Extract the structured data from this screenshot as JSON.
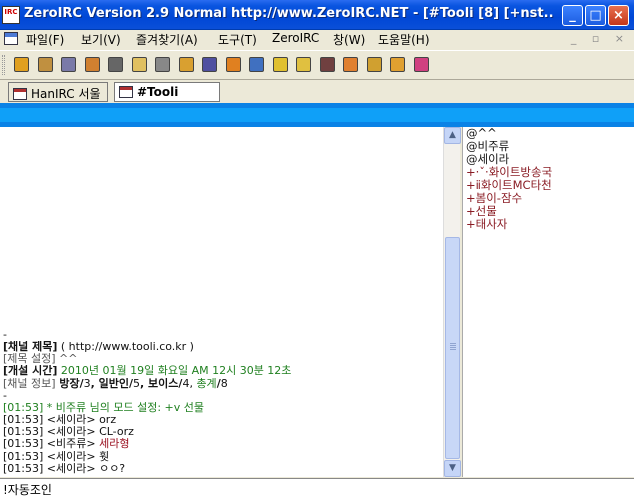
{
  "window": {
    "title": "ZeroIRC Version 2.9 Normal http://www.ZeroIRC.NET - [#Tooli [8] [+nst...",
    "app_icon_text": "IRC",
    "minimize": "_",
    "maximize": "□",
    "close": "×"
  },
  "menu": {
    "items": [
      "파일(F)",
      "보기(V)",
      "즐겨찾기(A)",
      "도구(T)",
      "ZeroIRC",
      "창(W)",
      "도움말(H)"
    ],
    "mdi_controls": "_ ▫ ×"
  },
  "toolbar": {
    "icons": [
      "connect-icon",
      "channel-icon",
      "server-icon",
      "user-icon",
      "edit-icon",
      "erase-icon",
      "timer-icon",
      "copy-icon",
      "paste-icon",
      "folder-icon",
      "options-icon",
      "refresh-icon",
      "open-icon",
      "palette-icon",
      "pie-icon",
      "layout-vertical-icon",
      "layout-cascade-icon",
      "about-icon"
    ]
  },
  "tabs": [
    {
      "label": "HanIRC 서울",
      "active": false
    },
    {
      "label": "#Tooli",
      "active": true
    }
  ],
  "chat": {
    "lines": [
      {
        "text": "-",
        "style": "black"
      },
      {
        "text": "[채널 제목] ( http://www.tooli.co.kr )",
        "parts": [
          [
            "[채널 제목]",
            "dark"
          ],
          [
            " ( http://www.tooli.co.kr )",
            "black"
          ]
        ]
      },
      {
        "parts": [
          [
            "[제목 설정]",
            "grey"
          ],
          [
            " ^^",
            "grey"
          ]
        ]
      },
      {
        "parts": [
          [
            "[개설 시간]",
            "dark"
          ],
          [
            " 2010년 01월 19일 화요일 AM 12시 30분 12초",
            "green"
          ]
        ]
      },
      {
        "parts": [
          [
            "[채널 정보]",
            "grey"
          ],
          [
            " 방장/",
            "dark"
          ],
          [
            "3",
            "black"
          ],
          [
            ", 일반인/",
            "dark"
          ],
          [
            "5",
            "black"
          ],
          [
            ", 보이스/",
            "dark"
          ],
          [
            "4",
            "black"
          ],
          [
            ", ",
            "black"
          ],
          [
            "총계",
            "green"
          ],
          [
            "/",
            "dark"
          ],
          [
            "8",
            "black"
          ]
        ]
      },
      {
        "parts": [
          [
            "-",
            "black"
          ]
        ]
      },
      {
        "parts": [
          [
            "[01:53] * 비주류 님의 모드 설정: +v 선물",
            "green"
          ]
        ]
      },
      {
        "parts": [
          [
            "[01:53] <세이라> orz",
            "black"
          ]
        ]
      },
      {
        "parts": [
          [
            "[01:53] <세이라> CL-orz",
            "black"
          ]
        ]
      },
      {
        "parts": [
          [
            "[01:53] <비주류> ",
            "black"
          ],
          [
            "세라형",
            "maroon"
          ]
        ]
      },
      {
        "parts": [
          [
            "[01:53] <세이라> 훳",
            "black"
          ]
        ]
      },
      {
        "parts": [
          [
            "[01:53] <세이라> ㅇㅇ?",
            "black"
          ]
        ]
      }
    ]
  },
  "nicklist": [
    {
      "nick": "@^^",
      "type": "op"
    },
    {
      "nick": "@비주류",
      "type": "op"
    },
    {
      "nick": "@세이라",
      "type": "op"
    },
    {
      "nick": "+·ˇ·화이트방송국",
      "type": "voice"
    },
    {
      "nick": "+ⅱ화이트MC타천",
      "type": "voice"
    },
    {
      "nick": "+봄이-잠수",
      "type": "voice"
    },
    {
      "nick": "+선물",
      "type": "voice"
    },
    {
      "nick": "+태사자",
      "type": "voice"
    }
  ],
  "input": {
    "value": "!자동조인"
  },
  "colors": {
    "titlebar": "#0a55e0",
    "band": "#0a82e6",
    "timestamp_green": "#208020",
    "voice_maroon": "#8a1c24"
  }
}
